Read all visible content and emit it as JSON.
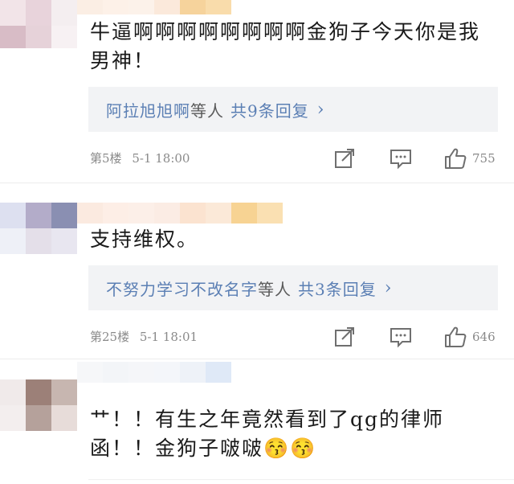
{
  "comments": [
    {
      "text": "牛逼啊啊啊啊啊啊啊啊金狗子今天你是我男神！",
      "reply_names": "阿拉旭旭啊",
      "reply_mid": "等人",
      "reply_count": "共9条回复",
      "floor": "第5楼",
      "time": "5-1 18:00",
      "likes": "755"
    },
    {
      "text": "支持维权。",
      "reply_names": "不努力学习不改名字",
      "reply_mid": "等人",
      "reply_count": "共3条回复",
      "floor": "第25楼",
      "time": "5-1 18:01",
      "likes": "646"
    },
    {
      "text": "艹！！有生之年竟然看到了qg的律师函！！金狗子啵啵😚😚"
    }
  ],
  "colors": {
    "link": "#5b7fb4",
    "reply_bg": "#f2f3f5",
    "meta": "#8a8a8a"
  },
  "icons": [
    "share-icon",
    "comment-icon",
    "thumbs-up-icon",
    "chevron-right-icon"
  ]
}
